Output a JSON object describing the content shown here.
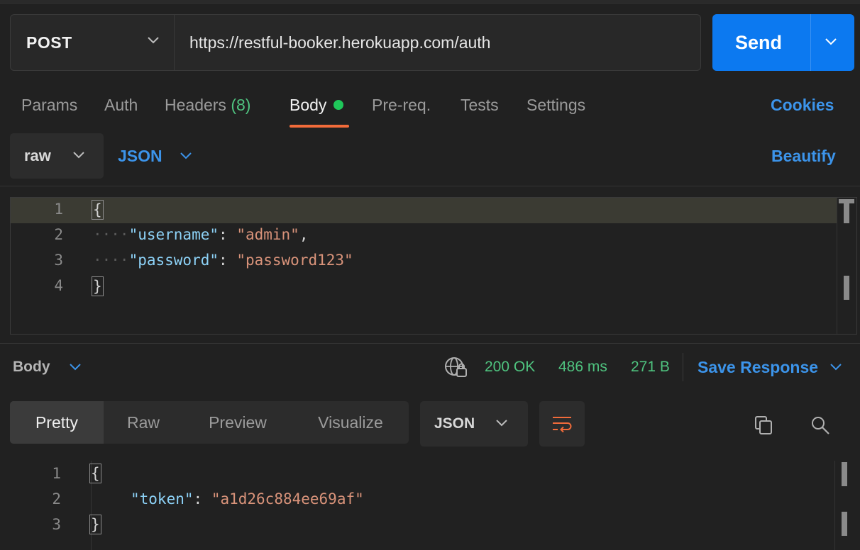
{
  "request": {
    "method": "POST",
    "url": "https://restful-booker.herokuapp.com/auth",
    "send_label": "Send"
  },
  "tabs": {
    "params": "Params",
    "auth": "Auth",
    "headers": "Headers",
    "headers_count": "(8)",
    "body": "Body",
    "prereq": "Pre-req.",
    "tests": "Tests",
    "settings": "Settings",
    "cookies": "Cookies"
  },
  "body_mode": {
    "mode": "raw",
    "language": "JSON",
    "beautify": "Beautify"
  },
  "request_editor": {
    "line_numbers": [
      "1",
      "2",
      "3",
      "4"
    ],
    "open_brace": "{",
    "close_brace": "}",
    "indent": "····",
    "username_key": "\"username\"",
    "username_value": "\"admin\"",
    "password_key": "\"password\"",
    "password_value": "\"password123\""
  },
  "response": {
    "section_label": "Body",
    "status": "200 OK",
    "time": "486 ms",
    "size": "271 B",
    "save_response": "Save Response",
    "views": [
      "Pretty",
      "Raw",
      "Preview",
      "Visualize"
    ],
    "format": "JSON",
    "line_numbers": [
      "1",
      "2",
      "3"
    ],
    "open_brace": "{",
    "close_brace": "}",
    "token_key": "\"token\"",
    "token_value": "\"a1d26c884ee69af\""
  },
  "colors": {
    "send_button": "#0c79f0",
    "accent_link": "#3c94ea",
    "status_green": "#4fc37f",
    "active_tab_underline": "#f26b3a",
    "json_key": "#8dd2f7",
    "json_string": "#d9937a"
  },
  "icons": {
    "method_dropdown": "chevron-down-icon",
    "send_dropdown": "chevron-down-icon",
    "network": "globe-lock-icon",
    "wrap": "word-wrap-icon",
    "copy": "copy-icon",
    "search": "search-icon"
  }
}
